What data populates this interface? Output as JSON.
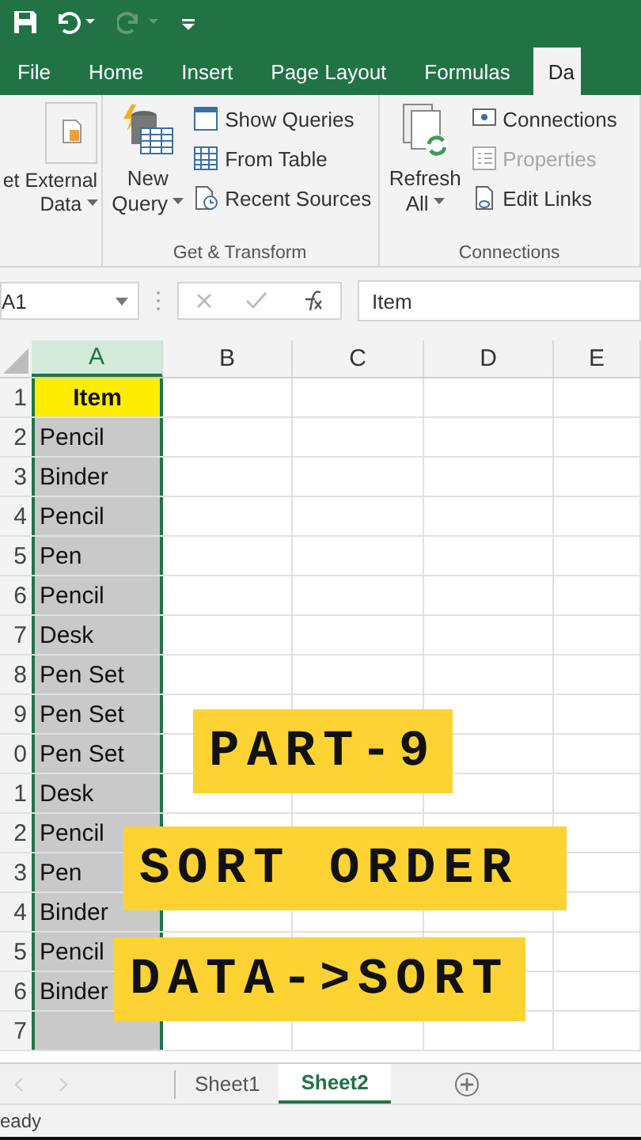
{
  "ribbon_tabs": [
    {
      "label": "File",
      "selected": false
    },
    {
      "label": "Home",
      "selected": false
    },
    {
      "label": "Insert",
      "selected": false
    },
    {
      "label": "Page Layout",
      "selected": false
    },
    {
      "label": "Formulas",
      "selected": false
    },
    {
      "label": "Da",
      "selected": true
    }
  ],
  "ribbon": {
    "external": {
      "lines": [
        "et External",
        "Data"
      ]
    },
    "get_transform": {
      "new_query": [
        "New",
        "Query"
      ],
      "items": [
        {
          "label": "Show Queries",
          "disabled": false
        },
        {
          "label": "From Table",
          "disabled": false
        },
        {
          "label": "Recent Sources",
          "disabled": false
        }
      ],
      "label": "Get & Transform"
    },
    "connections": {
      "refresh": [
        "Refresh",
        "All"
      ],
      "items": [
        {
          "label": "Connections",
          "disabled": false
        },
        {
          "label": "Properties",
          "disabled": true
        },
        {
          "label": "Edit Links",
          "disabled": false
        }
      ],
      "label": "Connections"
    }
  },
  "formula_bar": {
    "name_box": "A1",
    "formula": "Item"
  },
  "columns": [
    {
      "label": "A",
      "selected": true
    },
    {
      "label": "B",
      "selected": false
    },
    {
      "label": "C",
      "selected": false
    },
    {
      "label": "D",
      "selected": false
    },
    {
      "label": "E",
      "selected": false
    }
  ],
  "rows": [
    {
      "number": "1",
      "kind": "header",
      "cell": "Item"
    },
    {
      "number": "2",
      "kind": "item",
      "cell": "Pencil"
    },
    {
      "number": "3",
      "kind": "item",
      "cell": "Binder"
    },
    {
      "number": "4",
      "kind": "item",
      "cell": "Pencil"
    },
    {
      "number": "5",
      "kind": "item",
      "cell": "Pen"
    },
    {
      "number": "6",
      "kind": "item",
      "cell": "Pencil"
    },
    {
      "number": "7",
      "kind": "item",
      "cell": "Desk"
    },
    {
      "number": "8",
      "kind": "item",
      "cell": "Pen Set"
    },
    {
      "number": "9",
      "kind": "item",
      "cell": "Pen Set"
    },
    {
      "number": "0",
      "kind": "item",
      "cell": "Pen Set"
    },
    {
      "number": "1",
      "kind": "item",
      "cell": "Desk"
    },
    {
      "number": "2",
      "kind": "item",
      "cell": "Pencil"
    },
    {
      "number": "3",
      "kind": "item",
      "cell": "Pen"
    },
    {
      "number": "4",
      "kind": "item",
      "cell": "Binder"
    },
    {
      "number": "5",
      "kind": "item",
      "cell": "Pencil"
    },
    {
      "number": "6",
      "kind": "item",
      "cell": "Binder"
    },
    {
      "number": "7",
      "kind": "item"
    }
  ],
  "captions": [
    "PART-9",
    "SORT ORDER",
    "DATA->SORT"
  ],
  "sheet_tabs": [
    {
      "label": "Sheet1",
      "selected": false
    },
    {
      "label": "Sheet2",
      "selected": true
    }
  ],
  "status_bar": "eady"
}
